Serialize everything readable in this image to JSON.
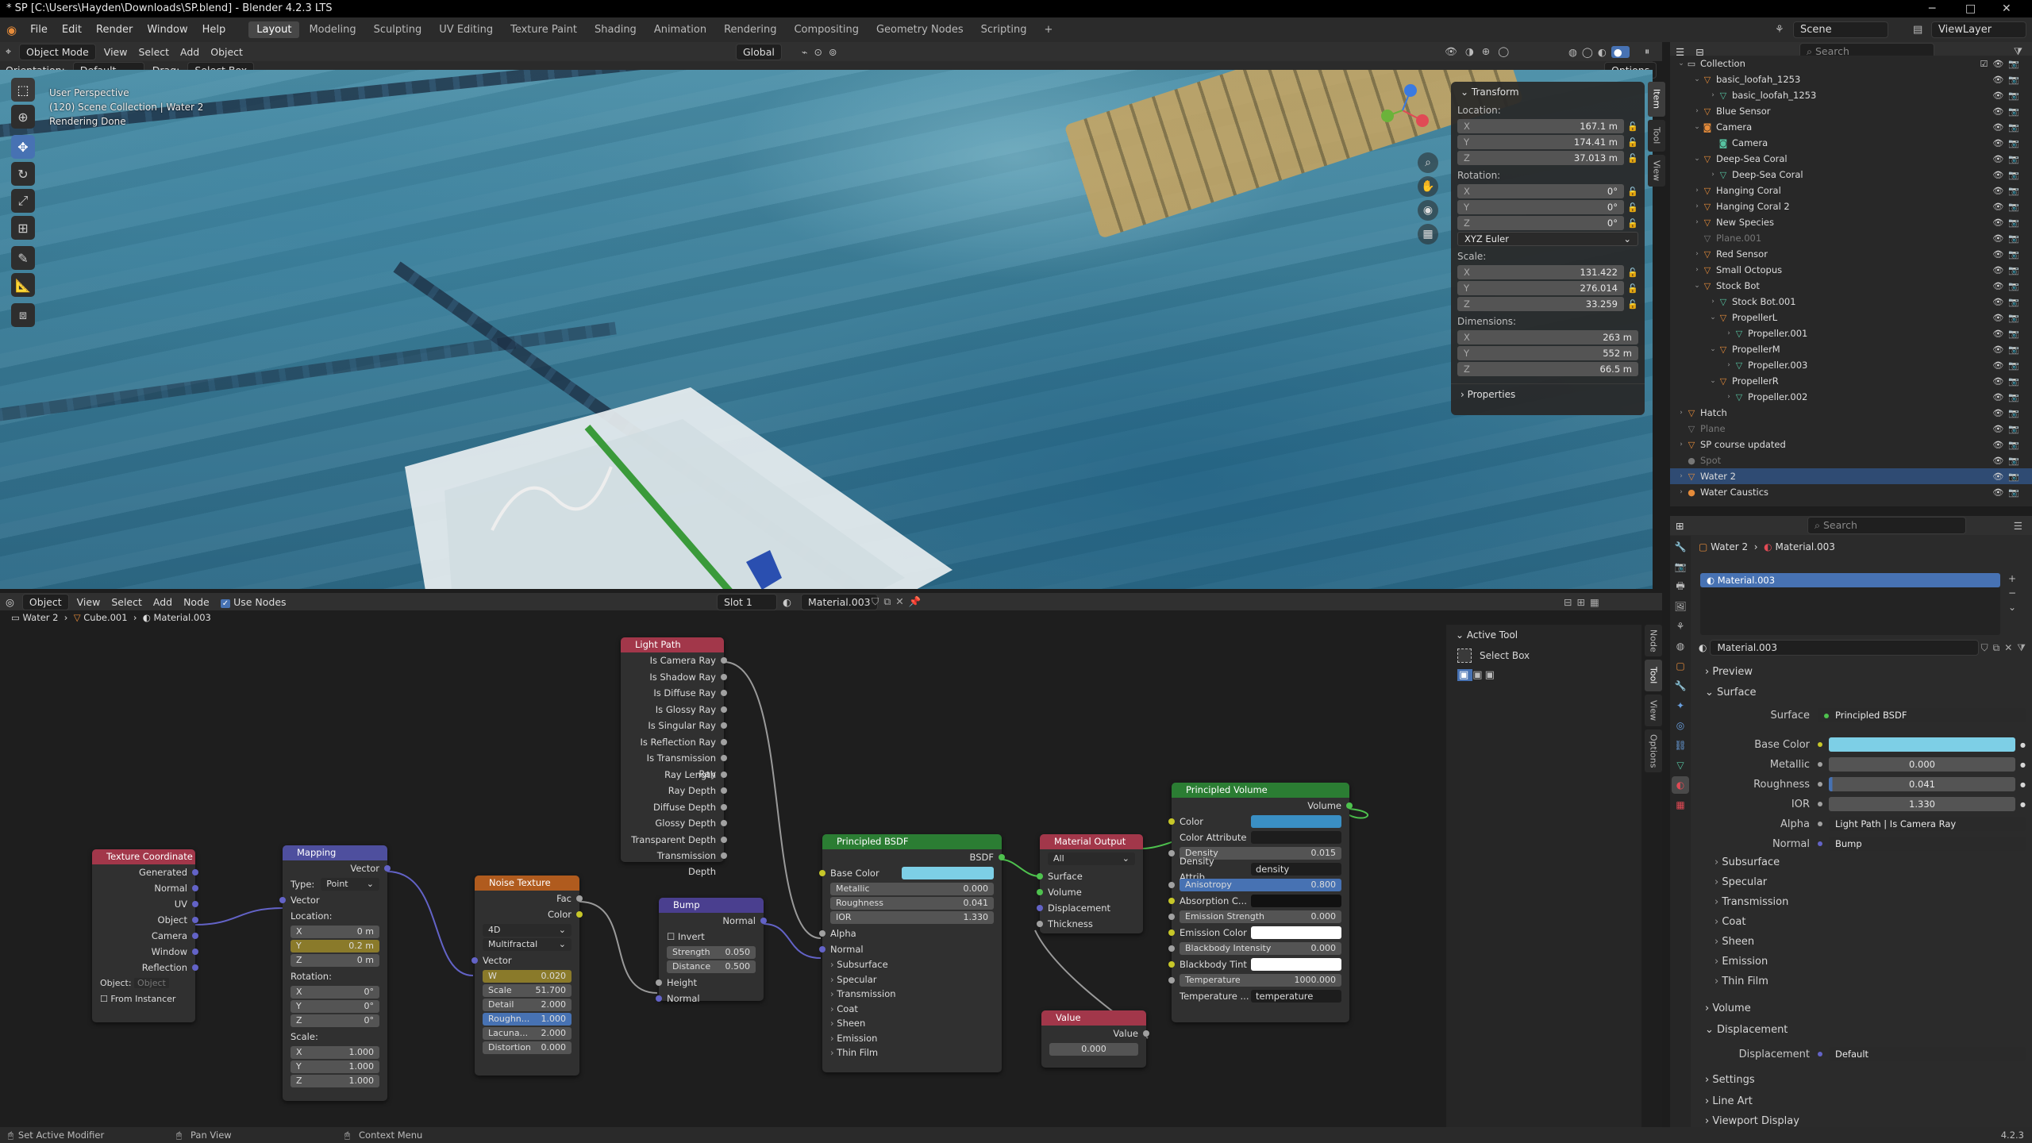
{
  "window": {
    "title": "* SP [C:\\Users\\Hayden\\Downloads\\SP.blend] - Blender 4.2.3 LTS",
    "min": "─",
    "max": "□",
    "close": "✕"
  },
  "menu": {
    "items": [
      "File",
      "Edit",
      "Render",
      "Window",
      "Help"
    ],
    "workspaces": [
      "Layout",
      "Modeling",
      "Sculpting",
      "UV Editing",
      "Texture Paint",
      "Shading",
      "Animation",
      "Rendering",
      "Compositing",
      "Geometry Nodes",
      "Scripting"
    ],
    "active_workspace": "Layout",
    "add": "+",
    "scene": "Scene",
    "view_layer": "ViewLayer"
  },
  "viewport_header": {
    "mode": "Object Mode",
    "view": "View",
    "select": "Select",
    "add": "Add",
    "object": "Object",
    "orientation_label": "Orientation:",
    "orientation": "Default",
    "drag_label": "Drag:",
    "drag": "Select Box",
    "transform": "Global",
    "options": "Options"
  },
  "viewport_overlay": {
    "line1": "User Perspective",
    "line2": "(120) Scene Collection | Water 2",
    "line3": "Rendering Done"
  },
  "npanel": {
    "transform": "Transform",
    "location": "Location:",
    "loc": [
      {
        "ax": "X",
        "v": "167.1 m"
      },
      {
        "ax": "Y",
        "v": "174.41 m"
      },
      {
        "ax": "Z",
        "v": "37.013 m"
      }
    ],
    "rotation": "Rotation:",
    "rot": [
      {
        "ax": "X",
        "v": "0°"
      },
      {
        "ax": "Y",
        "v": "0°"
      },
      {
        "ax": "Z",
        "v": "0°"
      }
    ],
    "rot_mode": "XYZ Euler",
    "scale": "Scale:",
    "scl": [
      {
        "ax": "X",
        "v": "131.422"
      },
      {
        "ax": "Y",
        "v": "276.014"
      },
      {
        "ax": "Z",
        "v": "33.259"
      }
    ],
    "dimensions": "Dimensions:",
    "dim": [
      {
        "ax": "X",
        "v": "263 m"
      },
      {
        "ax": "Y",
        "v": "552 m"
      },
      {
        "ax": "Z",
        "v": "66.5 m"
      }
    ],
    "properties": "Properties",
    "tabs": [
      "Item",
      "Tool",
      "View"
    ]
  },
  "outliner": {
    "search": "Search",
    "rows": [
      {
        "d": 0,
        "t": "⌄",
        "i": "▭",
        "n": "Collection",
        "c": "#ccc"
      },
      {
        "d": 1,
        "t": "⌄",
        "i": "▽",
        "n": "basic_loofah_1253",
        "c": "#e58b3a"
      },
      {
        "d": 2,
        "t": "›",
        "i": "▽",
        "n": "basic_loofah_1253",
        "c": "#56c2a0"
      },
      {
        "d": 1,
        "t": "›",
        "i": "▽",
        "n": "Blue Sensor",
        "c": "#e58b3a"
      },
      {
        "d": 1,
        "t": "⌄",
        "i": "◙",
        "n": "Camera",
        "c": "#e58b3a"
      },
      {
        "d": 2,
        "t": "",
        "i": "◙",
        "n": "Camera",
        "c": "#56c2a0"
      },
      {
        "d": 1,
        "t": "⌄",
        "i": "▽",
        "n": "Deep-Sea Coral",
        "c": "#e58b3a"
      },
      {
        "d": 2,
        "t": "›",
        "i": "▽",
        "n": "Deep-Sea Coral",
        "c": "#56c2a0"
      },
      {
        "d": 1,
        "t": "›",
        "i": "▽",
        "n": "Hanging Coral",
        "c": "#e58b3a"
      },
      {
        "d": 1,
        "t": "›",
        "i": "▽",
        "n": "Hanging Coral 2",
        "c": "#e58b3a"
      },
      {
        "d": 1,
        "t": "›",
        "i": "▽",
        "n": "New Species",
        "c": "#e58b3a"
      },
      {
        "d": 1,
        "t": "",
        "i": "▽",
        "n": "Plane.001",
        "c": "#777",
        "dim": true
      },
      {
        "d": 1,
        "t": "›",
        "i": "▽",
        "n": "Red Sensor",
        "c": "#e58b3a"
      },
      {
        "d": 1,
        "t": "›",
        "i": "▽",
        "n": "Small Octopus",
        "c": "#e58b3a"
      },
      {
        "d": 1,
        "t": "⌄",
        "i": "▽",
        "n": "Stock Bot",
        "c": "#e58b3a"
      },
      {
        "d": 2,
        "t": "›",
        "i": "▽",
        "n": "Stock Bot.001",
        "c": "#56c2a0"
      },
      {
        "d": 2,
        "t": "⌄",
        "i": "▽",
        "n": "PropellerL",
        "c": "#e58b3a"
      },
      {
        "d": 3,
        "t": "›",
        "i": "▽",
        "n": "Propeller.001",
        "c": "#56c2a0"
      },
      {
        "d": 2,
        "t": "⌄",
        "i": "▽",
        "n": "PropellerM",
        "c": "#e58b3a"
      },
      {
        "d": 3,
        "t": "›",
        "i": "▽",
        "n": "Propeller.003",
        "c": "#56c2a0"
      },
      {
        "d": 2,
        "t": "⌄",
        "i": "▽",
        "n": "PropellerR",
        "c": "#e58b3a"
      },
      {
        "d": 3,
        "t": "›",
        "i": "▽",
        "n": "Propeller.002",
        "c": "#56c2a0"
      },
      {
        "d": 0,
        "t": "›",
        "i": "▽",
        "n": "Hatch",
        "c": "#e58b3a"
      },
      {
        "d": 0,
        "t": "",
        "i": "▽",
        "n": "Plane",
        "c": "#777",
        "dim": true
      },
      {
        "d": 0,
        "t": "›",
        "i": "▽",
        "n": "SP course updated",
        "c": "#e58b3a"
      },
      {
        "d": 0,
        "t": "",
        "i": "●",
        "n": "Spot",
        "c": "#777",
        "dim": true
      },
      {
        "d": 0,
        "t": "›",
        "i": "▽",
        "n": "Water 2",
        "c": "#e58b3a",
        "sel": true
      },
      {
        "d": 0,
        "t": "›",
        "i": "●",
        "n": "Water Caustics",
        "c": "#e58b3a"
      }
    ]
  },
  "node_header": {
    "object": "Object",
    "view": "View",
    "select": "Select",
    "add": "Add",
    "node": "Node",
    "use_nodes": "Use Nodes",
    "slot": "Slot 1",
    "material": "Material.003"
  },
  "node_breadcrumb": [
    "Water 2",
    "Cube.001",
    "Material.003"
  ],
  "nodes": {
    "texcoord": {
      "title": "Texture Coordinate",
      "outputs": [
        "Generated",
        "Normal",
        "UV",
        "Object",
        "Camera",
        "Window",
        "Reflection"
      ],
      "object_label": "Object:",
      "object_ph": "Object",
      "from_instancer": "From Instancer"
    },
    "mapping": {
      "title": "Mapping",
      "out": "Vector",
      "type_label": "Type:",
      "type": "Point",
      "vector": "Vector",
      "location": "Location:",
      "loc": [
        [
          "X",
          "0 m"
        ],
        [
          "Y",
          "0.2 m"
        ],
        [
          "Z",
          "0 m"
        ]
      ],
      "rotation": "Rotation:",
      "rot": [
        [
          "X",
          "0°"
        ],
        [
          "Y",
          "0°"
        ],
        [
          "Z",
          "0°"
        ]
      ],
      "scale": "Scale:",
      "scl": [
        [
          "X",
          "1.000"
        ],
        [
          "Y",
          "1.000"
        ],
        [
          "Z",
          "1.000"
        ]
      ]
    },
    "noise": {
      "title": "Noise Texture",
      "outs": [
        "Fac",
        "Color"
      ],
      "dim": "4D",
      "type": "Multifractal",
      "vector": "Vector",
      "fields": [
        [
          "W",
          "0.020"
        ],
        [
          "Scale",
          "51.700"
        ],
        [
          "Detail",
          "2.000"
        ],
        [
          "Roughn...",
          "1.000"
        ],
        [
          "Lacuna...",
          "2.000"
        ],
        [
          "Distortion",
          "0.000"
        ]
      ]
    },
    "lightpath": {
      "title": "Light Path",
      "outs": [
        "Is Camera Ray",
        "Is Shadow Ray",
        "Is Diffuse Ray",
        "Is Glossy Ray",
        "Is Singular Ray",
        "Is Reflection Ray",
        "Is Transmission Ray",
        "Ray Length",
        "Ray Depth",
        "Diffuse Depth",
        "Glossy Depth",
        "Transparent Depth",
        "Transmission Depth"
      ]
    },
    "bump": {
      "title": "Bump",
      "out": "Normal",
      "invert": "Invert",
      "fields": [
        [
          "Strength",
          "0.050"
        ],
        [
          "Distance",
          "0.500"
        ]
      ],
      "ins": [
        "Height",
        "Normal"
      ]
    },
    "bsdf": {
      "title": "Principled BSDF",
      "out": "BSDF",
      "base": "Base Color",
      "fields": [
        [
          "Metallic",
          "0.000"
        ],
        [
          "Roughness",
          "0.041"
        ],
        [
          "IOR",
          "1.330"
        ]
      ],
      "ins": [
        "Alpha",
        "Normal"
      ],
      "subs": [
        "Subsurface",
        "Specular",
        "Transmission",
        "Coat",
        "Sheen",
        "Emission",
        "Thin Film"
      ]
    },
    "matout": {
      "title": "Material Output",
      "target": "All",
      "ins": [
        "Surface",
        "Volume",
        "Displacement",
        "Thickness"
      ]
    },
    "value": {
      "title": "Value",
      "out": "Value",
      "val": "0.000"
    },
    "volume": {
      "title": "Principled Volume",
      "out": "Volume",
      "color": "Color",
      "color_attr": "Color Attribute",
      "density": [
        "Density",
        "0.015"
      ],
      "dens_attr": [
        "Density Attrib...",
        "density"
      ],
      "aniso": [
        "Anisotropy",
        "0.800"
      ],
      "absorb": "Absorption C...",
      "emis": [
        "Emission Strength",
        "0.000"
      ],
      "emis_color": "Emission Color",
      "bb": [
        "Blackbody Intensity",
        "0.000"
      ],
      "bb_tint": "Blackbody Tint",
      "temp": [
        "Temperature",
        "1000.000"
      ],
      "temp_attr": [
        "Temperature ...",
        "temperature"
      ]
    }
  },
  "active_tool": {
    "title": "Active Tool",
    "tool": "Select Box",
    "tabs": [
      "Node",
      "Tool",
      "View",
      "Options"
    ]
  },
  "props": {
    "crumb_obj": "Water 2",
    "crumb_mat": "Material.003",
    "slot": "Material.003",
    "mat_name": "Material.003",
    "search": "Search",
    "preview": "Preview",
    "surface_sec": "Surface",
    "surface": [
      "Surface",
      "Principled BSDF"
    ],
    "rows": [
      [
        "Base Color",
        ""
      ],
      [
        "Metallic",
        "0.000"
      ],
      [
        "Roughness",
        "0.041"
      ],
      [
        "IOR",
        "1.330"
      ],
      [
        "Alpha",
        "Light Path | Is Camera Ray"
      ],
      [
        "Normal",
        "Bump"
      ]
    ],
    "subs": [
      "Subsurface",
      "Specular",
      "Transmission",
      "Coat",
      "Sheen",
      "Emission",
      "Thin Film"
    ],
    "volume": "Volume",
    "displacement_sec": "Displacement",
    "displacement": [
      "Displacement",
      "Default"
    ],
    "settings": "Settings",
    "lineart": "Line Art",
    "viewport_display": "Viewport Display"
  },
  "status": {
    "left": "Set Active Modifier",
    "mid": "Pan View",
    "right": "Context Menu",
    "version": "4.2.3"
  },
  "colors": {
    "accent": "#4772b3",
    "base_color": "#7dcfe6",
    "vol_color": "#3a8fc4"
  }
}
